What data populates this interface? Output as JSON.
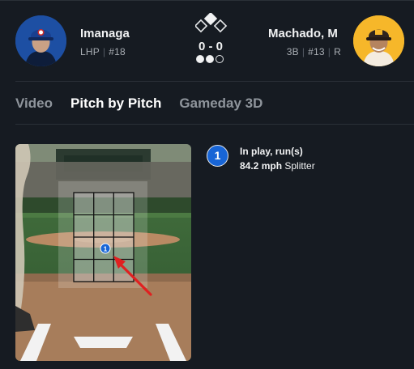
{
  "pitcher": {
    "name": "Imanaga",
    "hand": "LHP",
    "number": "#18"
  },
  "batter": {
    "name": "Machado, M",
    "position": "3B",
    "number": "#13",
    "bats": "R"
  },
  "game_state": {
    "score": "0 - 0",
    "bases_occupied": [
      false,
      false,
      false
    ],
    "outs": 2
  },
  "tabs": [
    {
      "label": "Video",
      "active": false
    },
    {
      "label": "Pitch by Pitch",
      "active": true
    },
    {
      "label": "Gameday 3D",
      "active": false
    }
  ],
  "pitch": {
    "number": "1",
    "result": "In play, run(s)",
    "speed": "84.2 mph",
    "type": "Splitter",
    "marker_color": "#1865d6"
  },
  "icons": [
    "pitcher-avatar",
    "batter-avatar",
    "base-diamond-icon",
    "out-indicator-icon",
    "pitch-arrow-icon"
  ],
  "colors": {
    "background": "#161b22",
    "accent": "#1865d6",
    "arrow": "#e02020",
    "pitcher_team": "#1d4fa3",
    "batter_team": "#f6b72a"
  }
}
